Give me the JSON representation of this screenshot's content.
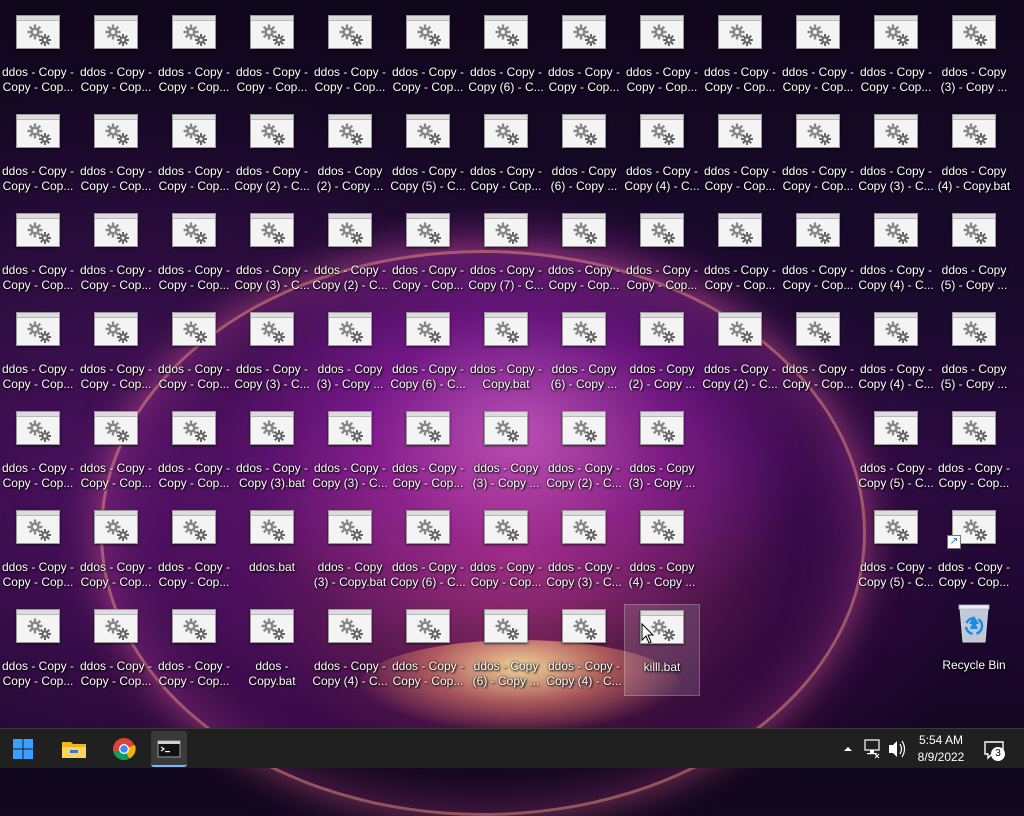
{
  "desktop": {
    "rows": [
      [
        "ddos - Copy -\nCopy - Cop...",
        "ddos - Copy -\nCopy - Cop...",
        "ddos - Copy -\nCopy - Cop...",
        "ddos - Copy -\nCopy - Cop...",
        "ddos - Copy -\nCopy - Cop...",
        "ddos - Copy -\nCopy - Cop...",
        "ddos - Copy -\nCopy (6) - C...",
        "ddos - Copy -\nCopy - Cop...",
        "ddos - Copy -\nCopy - Cop...",
        "ddos - Copy -\nCopy - Cop...",
        "ddos - Copy -\nCopy - Cop...",
        "ddos - Copy -\nCopy - Cop...",
        "ddos - Copy\n(3) - Copy ..."
      ],
      [
        "ddos - Copy -\nCopy - Cop...",
        "ddos - Copy -\nCopy - Cop...",
        "ddos - Copy -\nCopy - Cop...",
        "ddos - Copy -\nCopy (2) - C...",
        "ddos - Copy\n(2) - Copy ...",
        "ddos - Copy -\nCopy (5) - C...",
        "ddos - Copy -\nCopy - Cop...",
        "ddos - Copy\n(6) - Copy ...",
        "ddos - Copy -\nCopy (4) - C...",
        "ddos - Copy -\nCopy - Cop...",
        "ddos - Copy -\nCopy - Cop...",
        "ddos - Copy -\nCopy (3) - C...",
        "ddos - Copy\n(4) - Copy.bat"
      ],
      [
        "ddos - Copy -\nCopy - Cop...",
        "ddos - Copy -\nCopy - Cop...",
        "ddos - Copy -\nCopy - Cop...",
        "ddos - Copy -\nCopy (3) - C...",
        "ddos - Copy -\nCopy (2) - C...",
        "ddos - Copy -\nCopy - Cop...",
        "ddos - Copy -\nCopy (7) - C...",
        "ddos - Copy -\nCopy - Cop...",
        "ddos - Copy -\nCopy - Cop...",
        "ddos - Copy -\nCopy - Cop...",
        "ddos - Copy -\nCopy - Cop...",
        "ddos - Copy -\nCopy (4) - C...",
        "ddos - Copy\n(5) - Copy ..."
      ],
      [
        "ddos - Copy -\nCopy - Cop...",
        "ddos - Copy -\nCopy - Cop...",
        "ddos - Copy -\nCopy - Cop...",
        "ddos - Copy -\nCopy (3) - C...",
        "ddos - Copy\n(3) - Copy ...",
        "ddos - Copy -\nCopy (6) - C...",
        "ddos - Copy -\nCopy.bat",
        "ddos - Copy\n(6) - Copy ...",
        "ddos - Copy\n(2) - Copy ...",
        "ddos - Copy -\nCopy (2) - C...",
        "ddos - Copy -\nCopy - Cop...",
        "ddos - Copy -\nCopy (4) - C...",
        "ddos - Copy\n(5) - Copy ..."
      ],
      [
        "ddos - Copy -\nCopy - Cop...",
        "ddos - Copy -\nCopy - Cop...",
        "ddos - Copy -\nCopy - Cop...",
        "ddos - Copy -\nCopy (3).bat",
        "ddos - Copy -\nCopy (3) - C...",
        "ddos - Copy -\nCopy - Cop...",
        "ddos - Copy\n(3) - Copy ...",
        "ddos - Copy -\nCopy (2) - C...",
        "ddos - Copy\n(3) - Copy ...",
        null,
        null,
        "ddos - Copy -\nCopy (5) - C...",
        "ddos - Copy -\nCopy - Cop..."
      ],
      [
        "ddos - Copy -\nCopy - Cop...",
        "ddos - Copy -\nCopy - Cop...",
        "ddos - Copy -\nCopy - Cop...",
        "ddos.bat",
        "ddos - Copy\n(3) - Copy.bat",
        "ddos - Copy -\nCopy (6) - C...",
        "ddos - Copy -\nCopy - Cop...",
        "ddos - Copy -\nCopy (3) - C...",
        "ddos - Copy\n(4) - Copy ...",
        null,
        null,
        "ddos - Copy -\nCopy (5) - C...",
        "ddos - Copy -\nCopy - Cop..."
      ],
      [
        "ddos - Copy -\nCopy - Cop...",
        "ddos - Copy -\nCopy - Cop...",
        "ddos - Copy -\nCopy - Cop...",
        "ddos -\nCopy.bat",
        "ddos - Copy -\nCopy (4) - C...",
        "ddos - Copy -\nCopy - Cop...",
        "ddos - Copy\n(6) - Copy ...",
        "ddos - Copy -\nCopy (4) - C...",
        "killl.bat",
        null,
        null,
        null,
        null
      ]
    ],
    "shortcut_icon_label": "ddos - Copy -\nCopy - Cop...",
    "recycle_bin_label": "Recycle Bin",
    "selected_label": "killl.bat"
  },
  "taskbar": {
    "start_icon": "windows-logo-icon",
    "pinned": [
      "file-explorer-icon",
      "chrome-icon",
      "command-prompt-icon"
    ],
    "tray_icons": [
      "chevron-up-icon",
      "network-icon",
      "volume-icon"
    ],
    "clock_time": "5:54 AM",
    "clock_date": "8/9/2022",
    "notification_count": "3"
  }
}
